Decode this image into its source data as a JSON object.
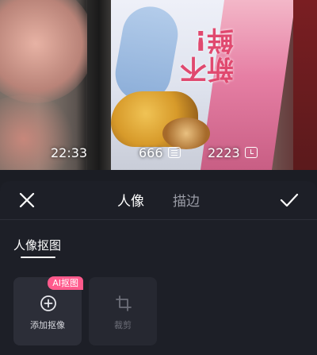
{
  "preview": {
    "clock_value": "2223",
    "list_value": "666",
    "time_value": "22:33",
    "clock_icon": "clock-icon",
    "list_icon": "list-icon"
  },
  "toolbar": {
    "close_icon": "close-icon",
    "confirm_icon": "check-icon",
    "tabs": [
      {
        "label": "人像",
        "active": true
      },
      {
        "label": "描边",
        "active": false
      }
    ]
  },
  "section": {
    "title": "人像抠图"
  },
  "cards": [
    {
      "label": "添加抠像",
      "icon": "add-circle-icon",
      "badge": "AI抠图",
      "enabled": true
    },
    {
      "label": "裁剪",
      "icon": "crop-icon",
      "enabled": false
    }
  ],
  "colors": {
    "accent_pink": "#ff5a8c",
    "sheet_bg": "#1d1f27",
    "card_bg": "#2c2e38"
  }
}
